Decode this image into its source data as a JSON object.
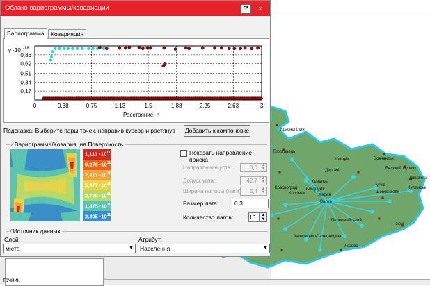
{
  "dialog": {
    "title": "Облако вариограммы/ковариации",
    "help_label": "?",
    "close_label": "x"
  },
  "tabs": [
    {
      "label": "Вариограмма",
      "active": true
    },
    {
      "label": "Коварияция",
      "active": false
    }
  ],
  "chart_data": {
    "type": "scatter",
    "ylabel": "γ ·10",
    "ylabel_exp": "-18",
    "xlabel": "Расстояние, h",
    "x_ticks": [
      "0",
      "0,38",
      "0,75",
      "1,13",
      "1,5",
      "1,88",
      "2,25",
      "2,63",
      "3"
    ],
    "y_ticks": [
      "0,17",
      "0,34",
      "0,51",
      "0,69",
      "0,86"
    ],
    "xlim": [
      0,
      3
    ],
    "ylim": [
      0,
      1.03
    ],
    "grid": true,
    "colors": {
      "highlight": "#2ad6e0",
      "normal": "#8b0d0d"
    },
    "series": [
      {
        "group": "highlight",
        "points": [
          [
            0.21,
            0.76
          ],
          [
            0.22,
            0.83
          ],
          [
            0.24,
            0.92
          ],
          [
            0.27,
            0.98
          ],
          [
            0.33,
            0.98
          ],
          [
            0.39,
            0.98
          ],
          [
            0.44,
            0.98
          ],
          [
            0.5,
            0.98
          ],
          [
            0.56,
            0.98
          ],
          [
            0.63,
            0.98
          ],
          [
            0.71,
            0.98
          ],
          [
            0.77,
            0.98
          ],
          [
            0.83,
            0.98
          ],
          [
            0.91,
            0.98
          ]
        ]
      },
      {
        "group": "normal",
        "points": [
          [
            0.86,
            1.0
          ],
          [
            0.95,
            0.98
          ],
          [
            1.12,
            0.99
          ],
          [
            1.2,
            0.99
          ],
          [
            1.25,
            1.0
          ],
          [
            1.38,
            1.0
          ],
          [
            1.43,
            0.98
          ],
          [
            1.49,
            0.99
          ],
          [
            1.53,
            0.99
          ],
          [
            1.7,
            0.65
          ],
          [
            1.72,
            0.68
          ],
          [
            1.71,
            0.99
          ],
          [
            1.86,
            0.97
          ],
          [
            2.0,
            0.99
          ],
          [
            2.04,
            0.98
          ],
          [
            2.22,
            0.99
          ],
          [
            2.38,
            0.99
          ],
          [
            2.47,
            0.99
          ],
          [
            2.57,
            0.98
          ],
          [
            2.64,
            0.98
          ],
          [
            2.72,
            0.98
          ],
          [
            2.78,
            0.99
          ],
          [
            2.87,
            0.98
          ],
          [
            2.95,
            0.99
          ]
        ]
      },
      {
        "group": "normal_band",
        "points": [
          [
            0.12,
            0.03
          ],
          [
            3.0,
            0.03
          ]
        ]
      }
    ]
  },
  "hint": "Подсказка: Выберите пары точек, направив курсор и растянув",
  "add_layout_button": "Добавить к компоновке",
  "surface": {
    "title": "Вариограмма/Коварияция Поверхность",
    "legend": [
      {
        "label": "1,113 ·10",
        "color": "#d22a1e"
      },
      {
        "label": "9,278 ·10",
        "color": "#e8661f"
      },
      {
        "label": "7,427 ·10",
        "color": "#f0a33a"
      },
      {
        "label": "5,577 ·10",
        "color": "#e5d34c"
      },
      {
        "label": "3,726 ·10",
        "color": "#b6d968"
      },
      {
        "label": "1,875 ·10",
        "color": "#5cc3b0"
      },
      {
        "label": "2,495 ·10",
        "color": "#3a8ec8"
      }
    ],
    "legend_exp": "11"
  },
  "direction": {
    "show_label": "Показать направление поиска",
    "angle_label": "Направление угла:",
    "angle_value": "0,0",
    "tolerance_label": "Допуск угла::",
    "tolerance_value": "42,7",
    "bandwidth_label": "Ширина полосы (лаги):",
    "bandwidth_value": "5,4",
    "lag_size_label": "Размер лага:",
    "lag_size_value": "0,3",
    "lag_count_label": "Количество лагов:",
    "lag_count_value": "10"
  },
  "source": {
    "title": "Источник данных",
    "layer_label": "Слой:",
    "layer_value": "міста",
    "attribute_label": "Атрибут:",
    "attribute_value": "Населення"
  },
  "map": {
    "fill": "#6fa66c",
    "border": "#2fc7e6",
    "cities": [
      "Краснопілля",
      "Тростянець",
      "Золочів",
      "Вовчанськ",
      "Великий Бурлук",
      "Дворічна",
      "Куп'янськ",
      "Чугуїв",
      "Шевченкове",
      "Дергачі",
      "Сахновщина",
      "Лозова",
      "Зачепилівка",
      "Первомайський",
      "Ізюм",
      "Красноград",
      "Коломак",
      "Богодухів",
      "Харків",
      "Валки",
      "Люботин"
    ]
  },
  "background": {
    "bottom_label": "точник"
  }
}
